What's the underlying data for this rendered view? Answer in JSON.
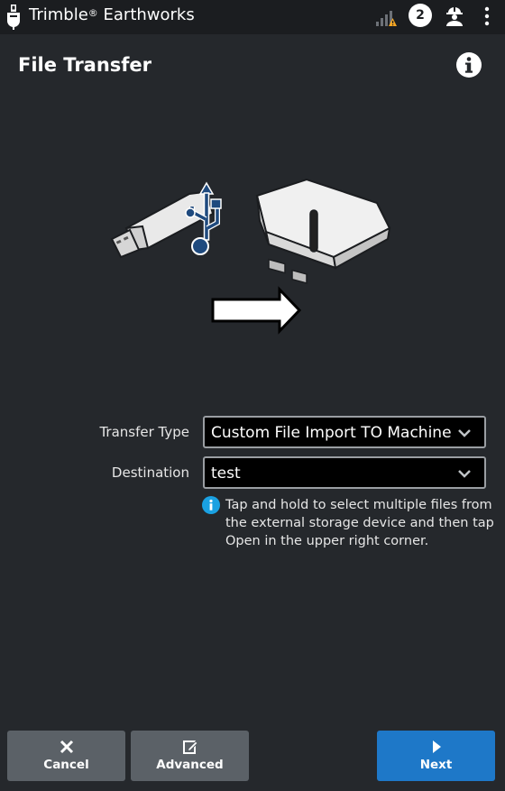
{
  "app": {
    "brand": "Trimble",
    "registered": "®",
    "product": "Earthworks"
  },
  "status": {
    "notification_count": "2"
  },
  "page": {
    "title": "File Transfer"
  },
  "form": {
    "transfer_type_label": "Transfer Type",
    "transfer_type_value": "Custom File Import TO Machine",
    "destination_label": "Destination",
    "destination_value": "test"
  },
  "hint": "Tap and hold to select multiple files from the external storage device and then tap Open in the upper right corner.",
  "buttons": {
    "cancel": "Cancel",
    "advanced": "Advanced",
    "next": "Next"
  },
  "icons": [
    "trimble-logo-icon",
    "signal-warning-icon",
    "operator-icon",
    "more-vert-icon",
    "info-icon",
    "usb-drive-icon",
    "usb-symbol-icon",
    "machine-controller-icon",
    "arrow-right-icon",
    "chevron-down-icon",
    "close-icon",
    "edit-icon",
    "play-icon"
  ],
  "colors": {
    "background": "#25282c",
    "topbar": "#1b1d20",
    "primary_button": "#1e78c8",
    "secondary_button": "#5b6167",
    "usb_blue": "#1f4a7e",
    "warning": "#f5a623",
    "info_blue": "#1aa1e2"
  }
}
